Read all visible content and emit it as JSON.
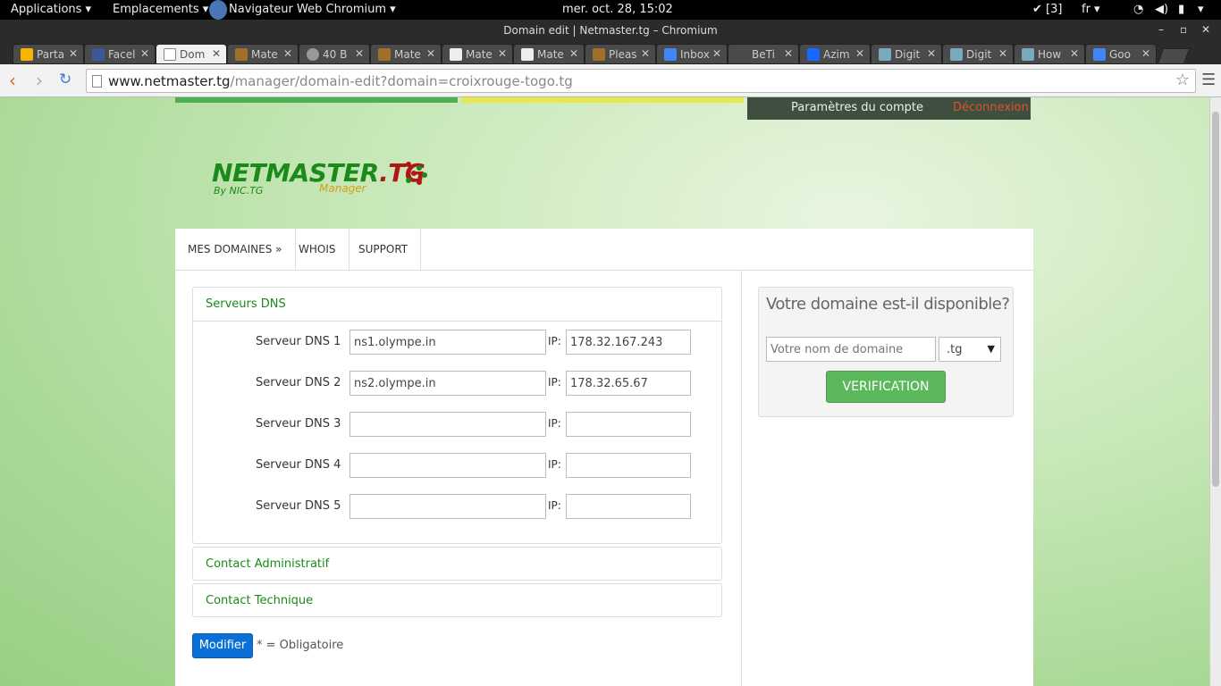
{
  "system": {
    "applications": "Applications",
    "places": "Emplacements",
    "browser": "Navigateur Web Chromium",
    "clock": "mer. oct. 28, 15:02",
    "updates": "[3]",
    "lang": "fr"
  },
  "window": {
    "title": "Domain edit | Netmaster.tg – Chromium"
  },
  "tabs": [
    {
      "label": "Parta"
    },
    {
      "label": "Facel"
    },
    {
      "label": "Dom"
    },
    {
      "label": "Mate"
    },
    {
      "label": "40 B"
    },
    {
      "label": "Mate"
    },
    {
      "label": "Mate"
    },
    {
      "label": "Mate"
    },
    {
      "label": "Pleas"
    },
    {
      "label": "Inbox"
    },
    {
      "label": "BeTi"
    },
    {
      "label": "Azim"
    },
    {
      "label": "Digit"
    },
    {
      "label": "Digit"
    },
    {
      "label": "How"
    },
    {
      "label": "Goo"
    }
  ],
  "omnibox": {
    "host": "www.netmaster.tg",
    "path": "/manager/domain-edit?domain=croixrouge-togo.tg"
  },
  "account": {
    "settings": "Paramètres du compte",
    "logout": "Déconnexion"
  },
  "logo": {
    "main": "NETMASTER",
    "tld": ".TG",
    "by": "By NIC.TG",
    "sub": "Manager"
  },
  "nav": {
    "domains": "MES DOMAINES »",
    "whois": "WHOIS",
    "support": "SUPPORT"
  },
  "dns": {
    "heading": "Serveurs DNS",
    "ip_label": "IP:",
    "rows": [
      {
        "label": "Serveur DNS 1",
        "host": "ns1.olympe.in",
        "ip": "178.32.167.243"
      },
      {
        "label": "Serveur DNS 2",
        "host": "ns2.olympe.in",
        "ip": "178.32.65.67"
      },
      {
        "label": "Serveur DNS 3",
        "host": "",
        "ip": ""
      },
      {
        "label": "Serveur DNS 4",
        "host": "",
        "ip": ""
      },
      {
        "label": "Serveur DNS 5",
        "host": "",
        "ip": ""
      }
    ]
  },
  "admin_contact": "Contact Administratif",
  "tech_contact": "Contact Technique",
  "form": {
    "submit": "Modifier",
    "required_note": "* = Obligatoire"
  },
  "search": {
    "title": "Votre domaine est-il disponible?",
    "placeholder": "Votre nom de domaine",
    "tld": ".tg",
    "button": "VERIFICATION"
  },
  "colors": {
    "brand_green": "#1a8a1a",
    "brand_red": "#b01818",
    "logout": "#e0502a",
    "submit_blue": "#0b6fd8",
    "verify_green": "#5cb85c"
  }
}
